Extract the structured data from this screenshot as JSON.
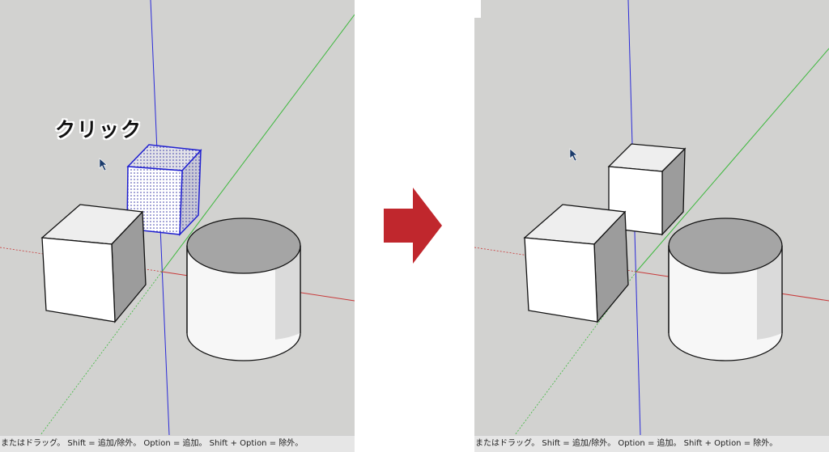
{
  "annotation": {
    "click_label": "クリック"
  },
  "status_bar": {
    "left_text": "またはドラッグ。 Shift = 追加/除外。 Option = 追加。 Shift + Option = 除外。",
    "right_text": "またはドラッグ。 Shift = 追加/除外。 Option = 追加。 Shift + Option = 除外。"
  },
  "colors": {
    "viewport_bg": "#d2d2d0",
    "axis_blue": "#2a2ad8",
    "axis_green": "#3cb83c",
    "axis_red": "#c83a3a",
    "selection_blue": "#2020d0",
    "arrow_red": "#c0272d"
  },
  "icons": {
    "cursor": "select-arrow-cursor",
    "transition": "right-arrow"
  }
}
